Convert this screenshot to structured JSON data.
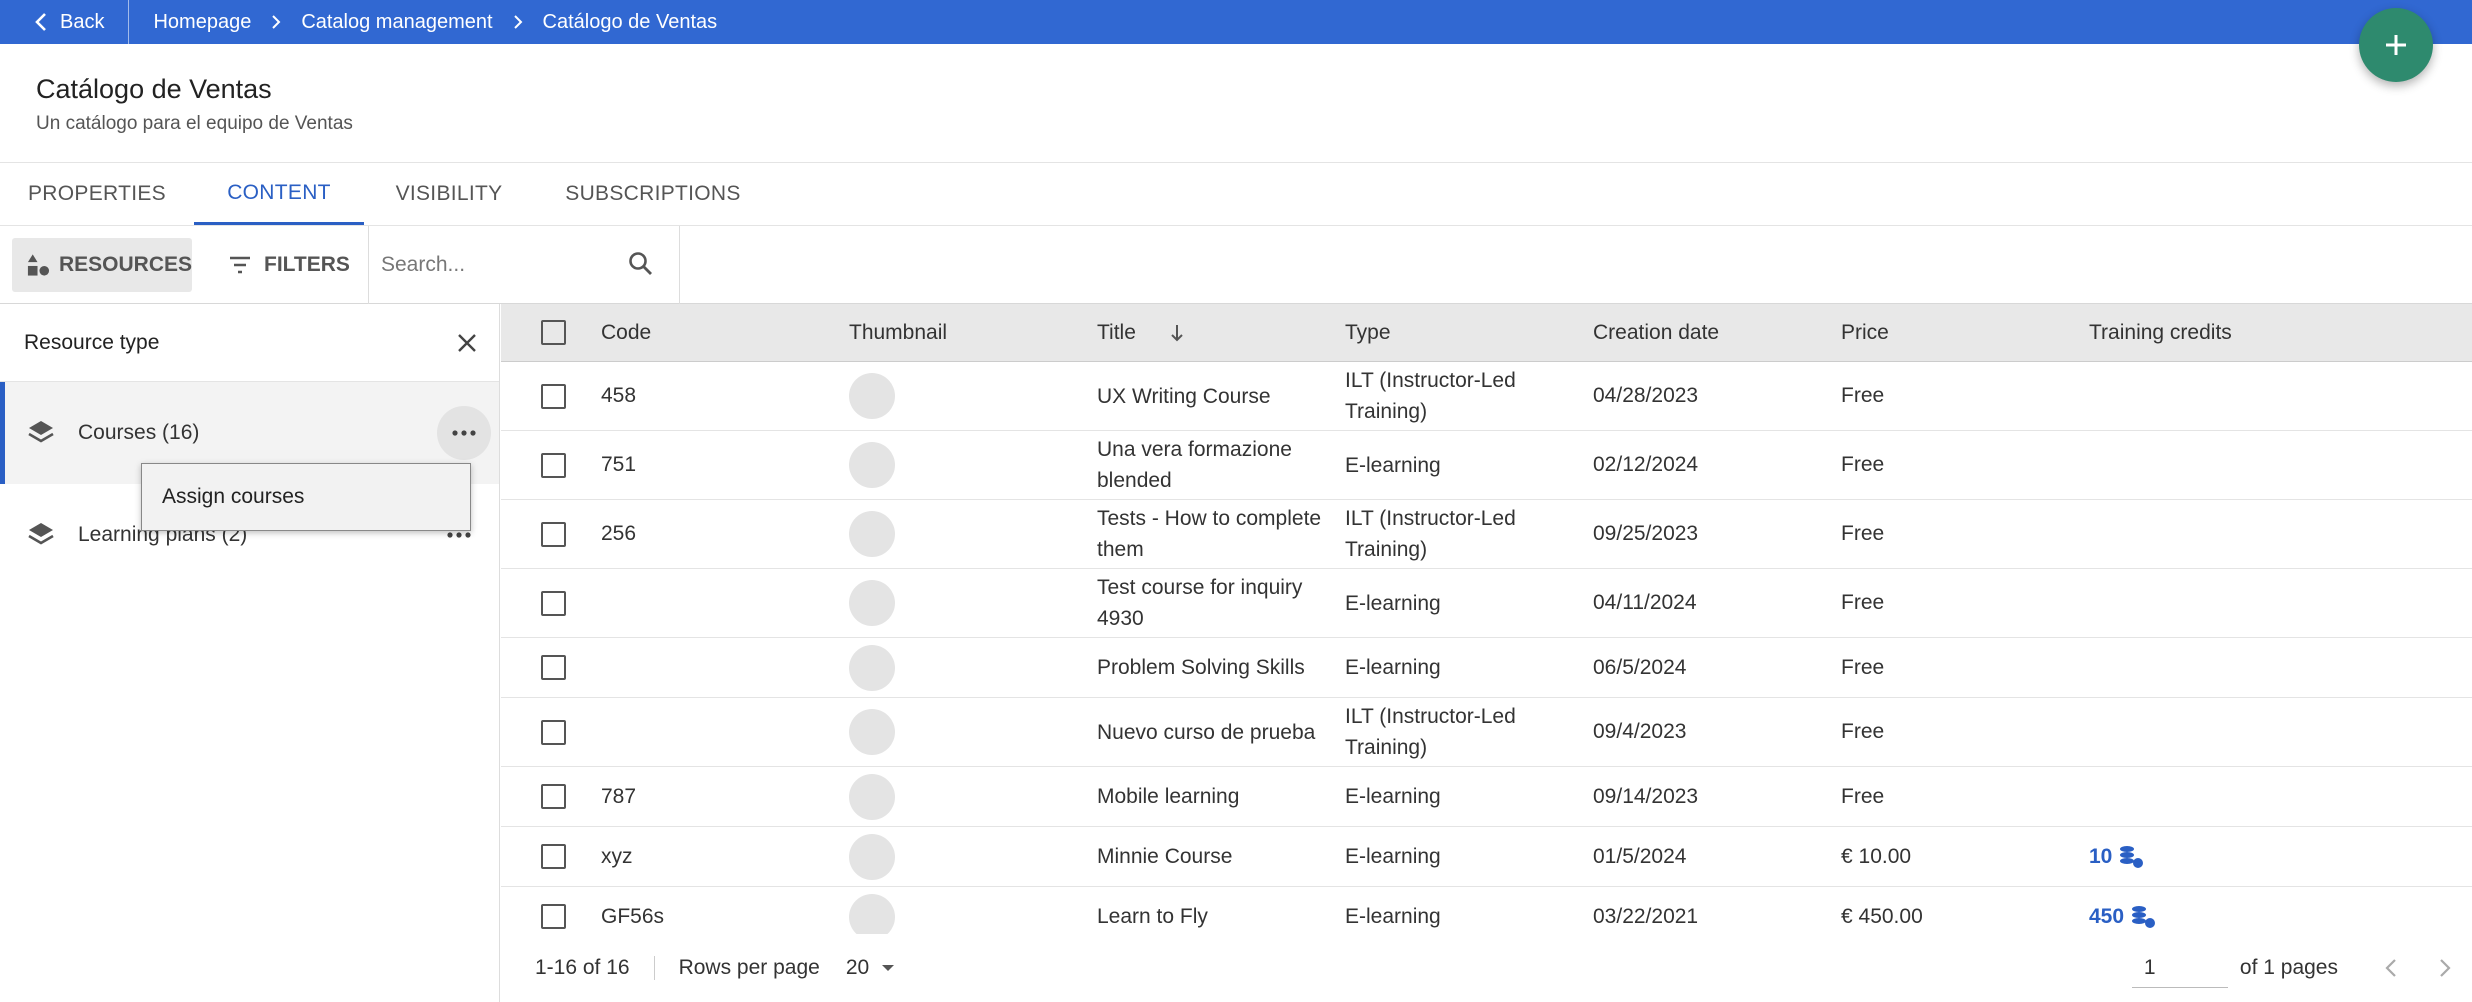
{
  "topbar": {
    "back_label": "Back",
    "breadcrumbs": [
      "Homepage",
      "Catalog management",
      "Catálogo de Ventas"
    ]
  },
  "header": {
    "title": "Catálogo de Ventas",
    "subtitle": "Un catálogo para el equipo de Ventas"
  },
  "tabs": [
    "PROPERTIES",
    "CONTENT",
    "VISIBILITY",
    "SUBSCRIPTIONS"
  ],
  "active_tab": "CONTENT",
  "toolbar": {
    "resources_label": "RESOURCES",
    "filters_label": "FILTERS",
    "search_placeholder": "Search..."
  },
  "panel": {
    "title": "Resource type",
    "items": [
      {
        "label": "Courses (16)",
        "selected": true
      },
      {
        "label": "Learning plans (2)",
        "selected": false
      }
    ],
    "context_menu": {
      "item": "Assign courses"
    }
  },
  "table": {
    "columns": {
      "code": "Code",
      "thumbnail": "Thumbnail",
      "title": "Title",
      "type": "Type",
      "date": "Creation date",
      "price": "Price",
      "credits": "Training credits"
    },
    "rows": [
      {
        "code": "458",
        "title": "UX Writing Course",
        "type": "ILT (Instructor-Led Training)",
        "date": "04/28/2023",
        "price": "Free",
        "credits": ""
      },
      {
        "code": "751",
        "title": "Una vera formazione blended",
        "type": "E-learning",
        "date": "02/12/2024",
        "price": "Free",
        "credits": ""
      },
      {
        "code": "256",
        "title": "Tests - How to complete them",
        "type": "ILT (Instructor-Led Training)",
        "date": "09/25/2023",
        "price": "Free",
        "credits": ""
      },
      {
        "code": "",
        "title": "Test course for inquiry 4930",
        "type": "E-learning",
        "date": "04/11/2024",
        "price": "Free",
        "credits": ""
      },
      {
        "code": "",
        "title": "Problem Solving Skills",
        "type": "E-learning",
        "date": "06/5/2024",
        "price": "Free",
        "credits": ""
      },
      {
        "code": "",
        "title": "Nuevo curso de prueba",
        "type": "ILT (Instructor-Led Training)",
        "date": "09/4/2023",
        "price": "Free",
        "credits": ""
      },
      {
        "code": "787",
        "title": "Mobile learning",
        "type": "E-learning",
        "date": "09/14/2023",
        "price": "Free",
        "credits": ""
      },
      {
        "code": "xyz",
        "title": "Minnie Course",
        "type": "E-learning",
        "date": "01/5/2024",
        "price": "€ 10.00",
        "credits": "10"
      },
      {
        "code": "GF56s",
        "title": "Learn to Fly",
        "type": "E-learning",
        "date": "03/22/2021",
        "price": "€ 450.00",
        "credits": "450"
      }
    ]
  },
  "pagination": {
    "range": "1-16 of 16",
    "rows_per_page_label": "Rows per page",
    "rows_per_page": "20",
    "page": "1",
    "of_pages": "of 1 pages"
  },
  "colors": {
    "topbar": "#3168d2",
    "accent": "#2a5fc4",
    "fab": "#2e8a6e"
  }
}
